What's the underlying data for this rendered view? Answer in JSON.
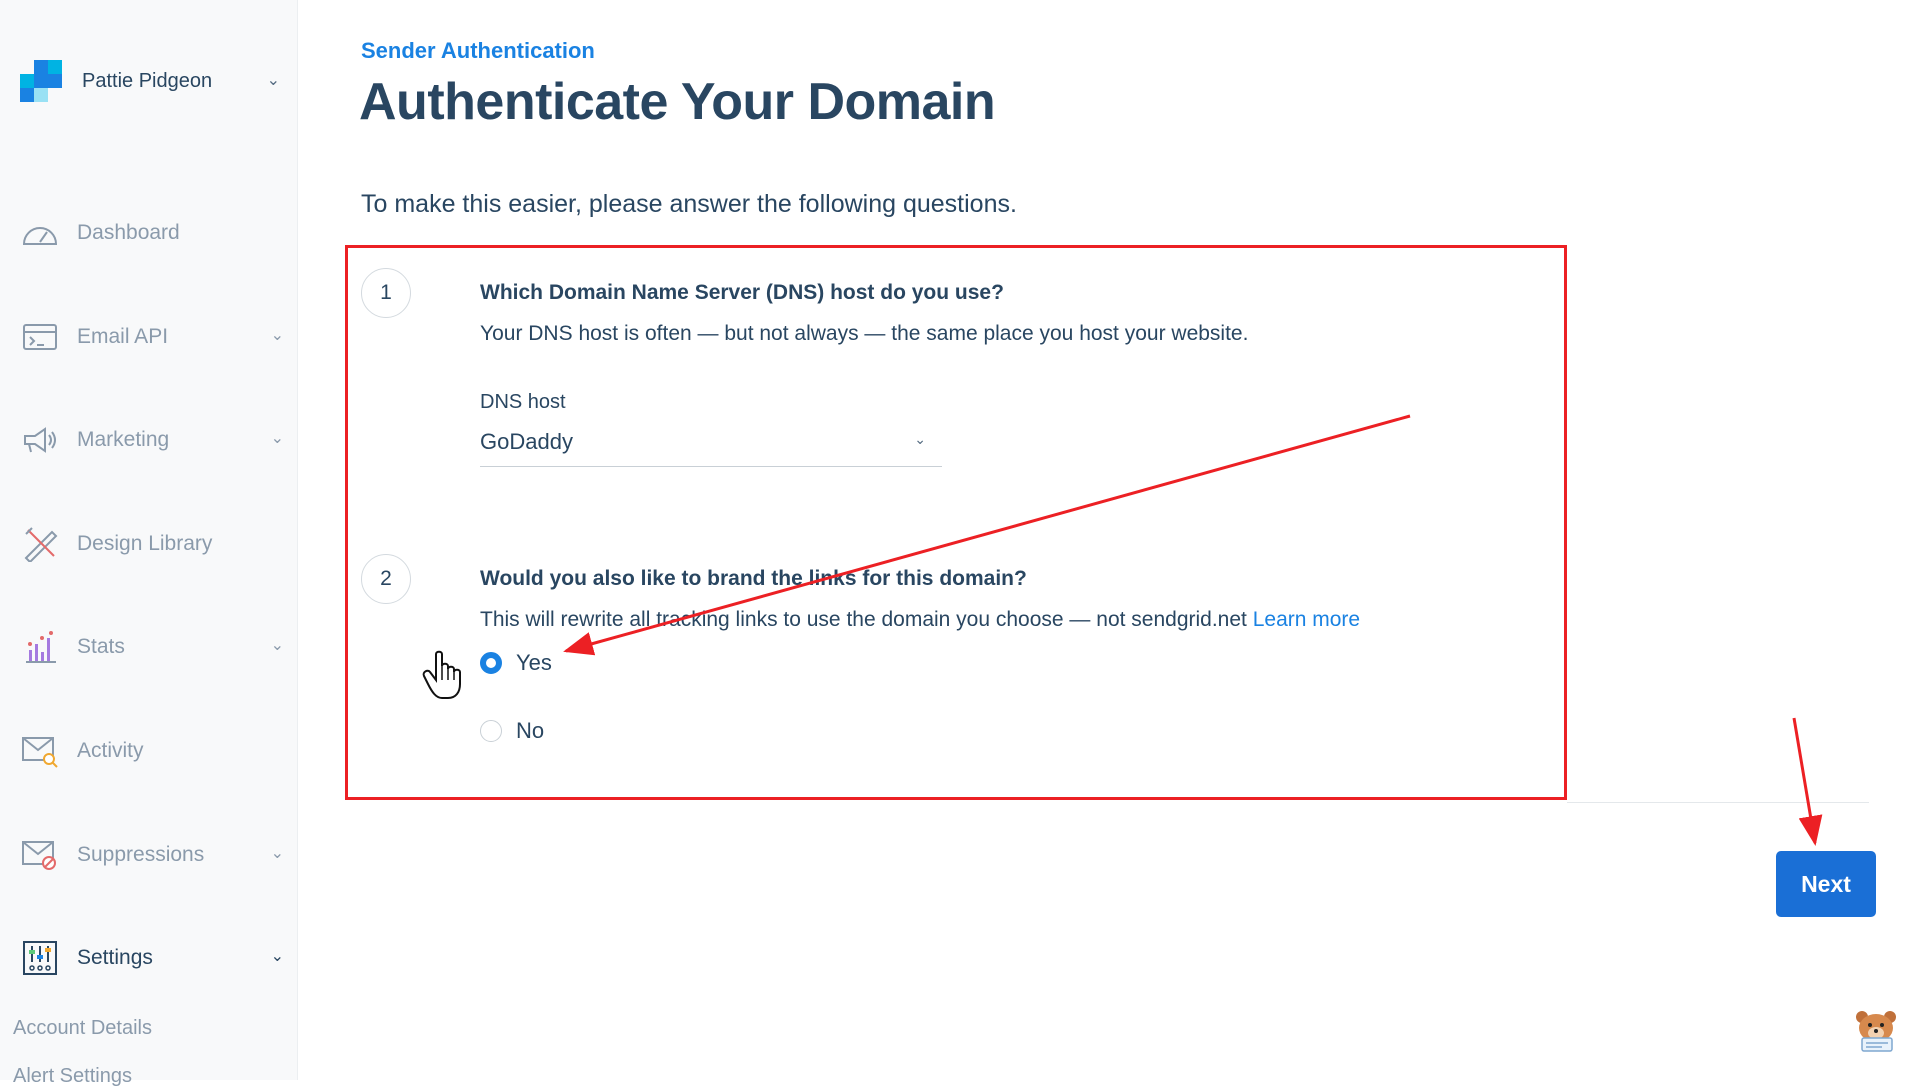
{
  "sidebar": {
    "account_name": "Pattie Pidgeon",
    "items": [
      {
        "label": "Dashboard",
        "icon": "dashboard-icon"
      },
      {
        "label": "Email API",
        "icon": "email-api-icon"
      },
      {
        "label": "Marketing",
        "icon": "megaphone-icon"
      },
      {
        "label": "Design Library",
        "icon": "design-library-icon"
      },
      {
        "label": "Stats",
        "icon": "stats-icon"
      },
      {
        "label": "Activity",
        "icon": "activity-icon"
      },
      {
        "label": "Suppressions",
        "icon": "suppressions-icon"
      },
      {
        "label": "Settings",
        "icon": "settings-icon"
      }
    ],
    "sub_items": [
      "Account Details",
      "Alert Settings"
    ]
  },
  "main": {
    "eyebrow": "Sender Authentication",
    "title": "Authenticate Your Domain",
    "intro": "To make this easier, please answer the following questions.",
    "question1": {
      "number": "1",
      "title": "Which Domain Name Server (DNS) host do you use?",
      "description": "Your DNS host is often — but not always — the same place you host your website.",
      "field_label": "DNS host",
      "selected": "GoDaddy"
    },
    "question2": {
      "number": "2",
      "title": "Would you also like to brand the links for this domain?",
      "description": "This will rewrite all tracking links to use the domain you choose — not sendgrid.net",
      "link": "Learn more",
      "options": [
        "Yes",
        "No"
      ],
      "selected": "Yes"
    },
    "next_label": "Next"
  },
  "colors": {
    "accent": "#1a82e2",
    "annotation": "#ec2024",
    "heading": "#294661",
    "muted": "#8a9aab"
  }
}
